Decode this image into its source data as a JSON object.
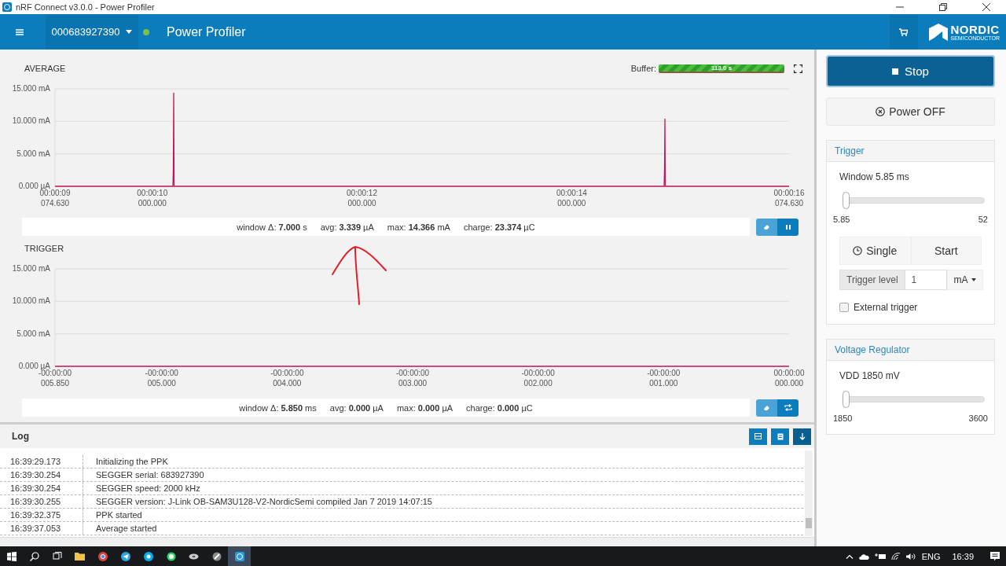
{
  "window": {
    "title": "nRF Connect v3.0.0 - Power Profiler"
  },
  "header": {
    "device": {
      "serial": "000683927390",
      "connected": true
    },
    "app_name": "Power Profiler",
    "logo": {
      "name": "NORDIC",
      "sub": "SEMICONDUCTOR"
    }
  },
  "average": {
    "title": "AVERAGE",
    "buffer": {
      "label": "Buffer:",
      "value": "113.0 s",
      "level": 1
    },
    "plot": {
      "kind": "spikes",
      "y_labels": [
        "15.000 mA",
        "10.000 mA",
        "5.000 mA",
        "0.000 µA"
      ],
      "x_labels": [
        "00:00:09 074.630",
        "00:00:10 000.000",
        "00:00:12 000.000",
        "00:00:14 000.000",
        "00:00:16 074.630"
      ]
    },
    "stats": [
      "window Δ: **7.000** s",
      "avg: **3.339** µA",
      "max: **14.366** mA",
      "charge: **23.374** µC"
    ],
    "buttons": [
      {
        "kind": "eraser"
      },
      {
        "kind": "pause"
      }
    ]
  },
  "trigger": {
    "title": "TRIGGER",
    "plot": {
      "kind": "flat",
      "y_labels": [
        "15.000 mA",
        "10.000 mA",
        "5.000 mA",
        "0.000 µA"
      ],
      "x_labels": [
        "-00:00:00 005.850",
        "-00:00:00 005.000",
        "-00:00:00 004.000",
        "-00:00:00 003.000",
        "-00:00:00 002.000",
        "-00:00:00 001.000",
        "00:00:00 000.000"
      ]
    },
    "stats": [
      "window Δ: **5.850** ms",
      "avg: **0.000** µA",
      "max: **0.000** µA",
      "charge: **0.000** µC"
    ],
    "buttons": [
      {
        "kind": "eraser"
      },
      {
        "kind": "repeat"
      }
    ]
  },
  "log": {
    "title": "Log",
    "buttons": [
      {
        "kind": "window"
      },
      {
        "kind": "document"
      },
      {
        "kind": "scroll-down"
      }
    ],
    "rows": [
      {
        "time": "16:39:29.173",
        "message": "Initializing the PPK"
      },
      {
        "time": "16:39:30.254",
        "message": "SEGGER serial: 683927390"
      },
      {
        "time": "16:39:30.254",
        "message": "SEGGER speed: 2000 kHz"
      },
      {
        "time": "16:39:30.255",
        "message": "SEGGER version: J-Link OB-SAM3U128-V2-NordicSemi compiled Jan 7 2019 14:07:15"
      },
      {
        "time": "16:39:32.375",
        "message": "PPK started"
      },
      {
        "time": "16:39:37.053",
        "message": "Average started"
      }
    ]
  },
  "sidebar": {
    "stop_button": "Stop",
    "power_button": "Power OFF",
    "trigger_card": {
      "title": "Trigger",
      "window_label": "Window 5.85 ms",
      "window_slider": {
        "level": 0,
        "min": "5.85",
        "max": "52"
      },
      "single_button": "Single",
      "start_button": "Start",
      "trigger_level": {
        "label": "Trigger level",
        "value": "1",
        "unit": "mA"
      },
      "external_trigger": {
        "label": "External trigger",
        "checked": false
      }
    },
    "voltage_card": {
      "title": "Voltage Regulator",
      "vdd_label": "VDD 1850 mV",
      "vdd_slider": {
        "level": 0,
        "min": "1850",
        "max": "3600"
      }
    }
  },
  "taskbar": {
    "language": "ENG",
    "time": "16:39"
  }
}
